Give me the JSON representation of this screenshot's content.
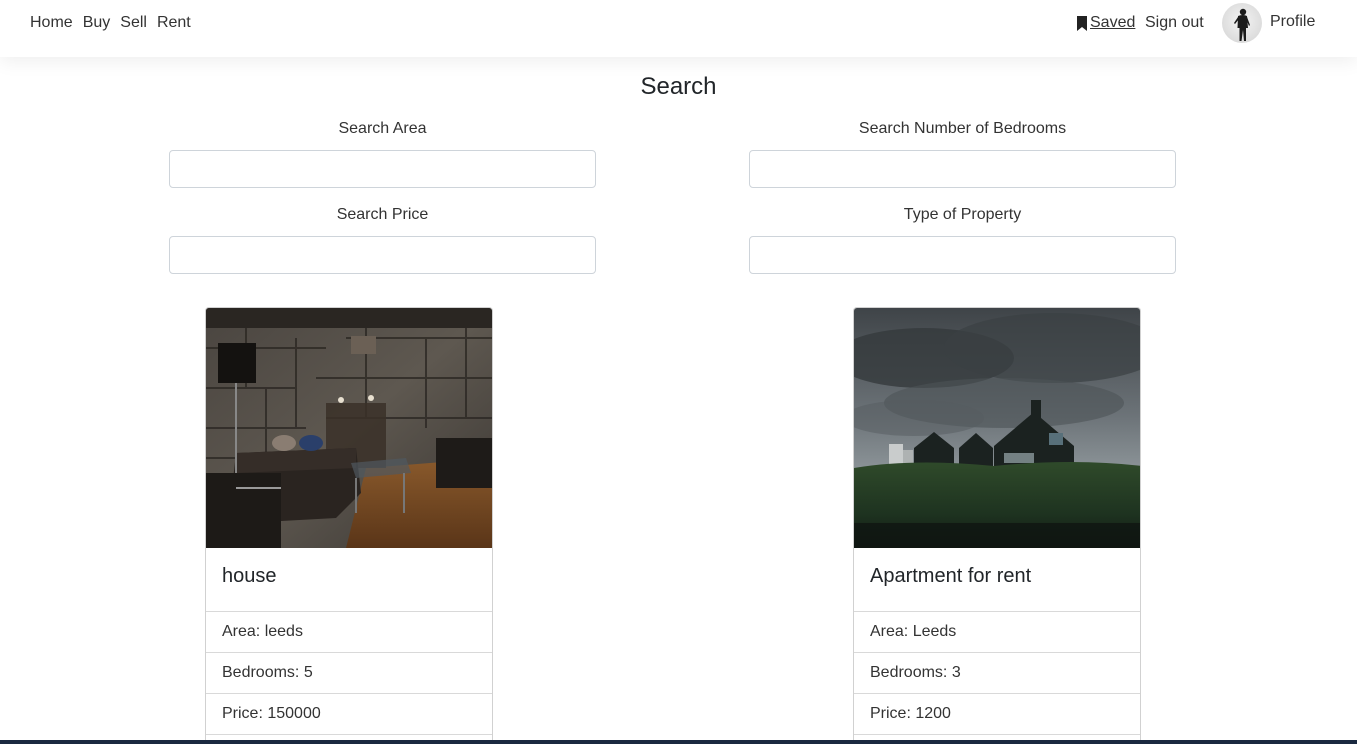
{
  "nav": {
    "links": [
      "Home",
      "Buy",
      "Sell",
      "Rent"
    ],
    "saved_label": "Saved",
    "signout_label": "Sign out",
    "profile_label": "Profile"
  },
  "search": {
    "title": "Search",
    "area_label": "Search Area",
    "area_value": "",
    "bedrooms_label": "Search Number of Bedrooms",
    "bedrooms_value": "",
    "price_label": "Search Price",
    "price_value": "",
    "type_label": "Type of Property",
    "type_value": ""
  },
  "listings": [
    {
      "title": "house",
      "area": "Area: leeds",
      "bedrooms": "Bedrooms: 5",
      "price": "Price: 150000",
      "image": "living-room-photo"
    },
    {
      "title": "Apartment for rent",
      "area": "Area: Leeds",
      "bedrooms": "Bedrooms: 3",
      "price": "Price: 1200",
      "image": "house-on-grass-stormy-sky-photo"
    }
  ],
  "icons": {
    "saved": "bookmark-icon",
    "avatar": "user-avatar"
  },
  "colors": {
    "text": "#212529",
    "border": "#ced4da",
    "bottom_bar": "#1a2940"
  }
}
